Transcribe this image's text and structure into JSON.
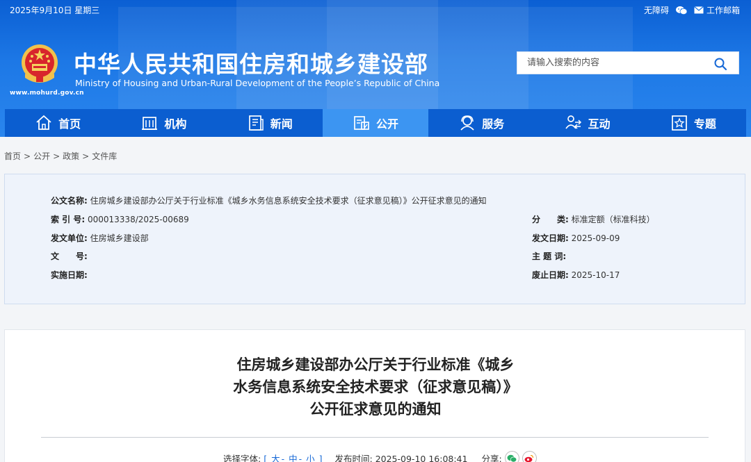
{
  "topbar": {
    "date": "2025年9月10日 星期三",
    "accessibility": "无障碍",
    "wechat_icon": "wechat-icon",
    "mail": "工作邮箱"
  },
  "header": {
    "url": "www.mohurd.gov.cn",
    "title": "中华人民共和国住房和城乡建设部",
    "subtitle": "Ministry of Housing and Urban-Rural Development of the People’s Republic of China",
    "search_placeholder": "请输入搜索的内容"
  },
  "nav": {
    "items": [
      {
        "label": "首页",
        "icon": "home-icon"
      },
      {
        "label": "机构",
        "icon": "building-icon"
      },
      {
        "label": "新闻",
        "icon": "news-icon"
      },
      {
        "label": "公开",
        "icon": "disclosure-icon"
      },
      {
        "label": "服务",
        "icon": "service-icon"
      },
      {
        "label": "互动",
        "icon": "interaction-icon"
      },
      {
        "label": "专题",
        "icon": "star-icon"
      }
    ],
    "active": "公开"
  },
  "breadcrumb": [
    "首页",
    "公开",
    "政策",
    "文件库"
  ],
  "info": {
    "title_label": "公文名称:",
    "title_value": "住房城乡建设部办公厅关于行业标准《城乡水务信息系统安全技术要求（征求意见稿）》公开征求意见的通知",
    "index_label": "索 引 号:",
    "index_value": "000013338/2025-00689",
    "category_label": "分　　类:",
    "category_value": "标准定额（标准科技）",
    "issuer_label": "发文单位:",
    "issuer_value": "住房城乡建设部",
    "issue_date_label": "发文日期:",
    "issue_date_value": "2025-09-09",
    "docno_label": "文　　号:",
    "docno_value": "",
    "subject_label": "主 题 词:",
    "subject_value": "",
    "effective_label": "实施日期:",
    "effective_value": "",
    "expiry_label": "废止日期:",
    "expiry_value": "2025-10-17"
  },
  "article": {
    "title_line1": "住房城乡建设部办公厅关于行业标准《城乡",
    "title_line2": "水务信息系统安全技术要求（征求意见稿）》",
    "title_line3": "公开征求意见的通知",
    "font_label": "选择字体:",
    "font_large": "大",
    "font_medium": "中",
    "font_small": "小",
    "publish_label": "发布时间:",
    "publish_time": "2025-09-10 16:08:41",
    "share_label": "分享:"
  },
  "colors": {
    "header_blue": "#1d78e6",
    "nav_blue": "#0b5ed0",
    "nav_active": "#3c95f2",
    "link_blue": "#1668d6"
  }
}
